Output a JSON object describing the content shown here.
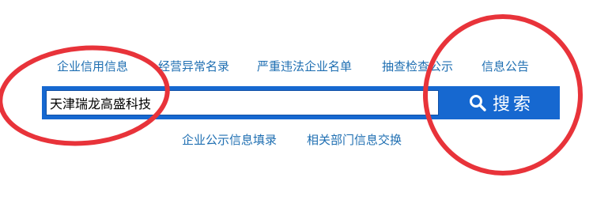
{
  "top_nav": [
    {
      "label": "企业信用信息"
    },
    {
      "label": "经营异常名录"
    },
    {
      "label": "严重违法企业名单"
    },
    {
      "label": "抽查检查公示"
    },
    {
      "label": "信息公告"
    }
  ],
  "search": {
    "value": "天津瑞龙高盛科技",
    "button_label": "搜索"
  },
  "bottom_nav": [
    {
      "label": "企业公示信息填录"
    },
    {
      "label": "相关部门信息交换"
    }
  ],
  "colors": {
    "link": "#1f6fb2",
    "search_bar": "#1668d0",
    "annotation": "#e8333a"
  }
}
